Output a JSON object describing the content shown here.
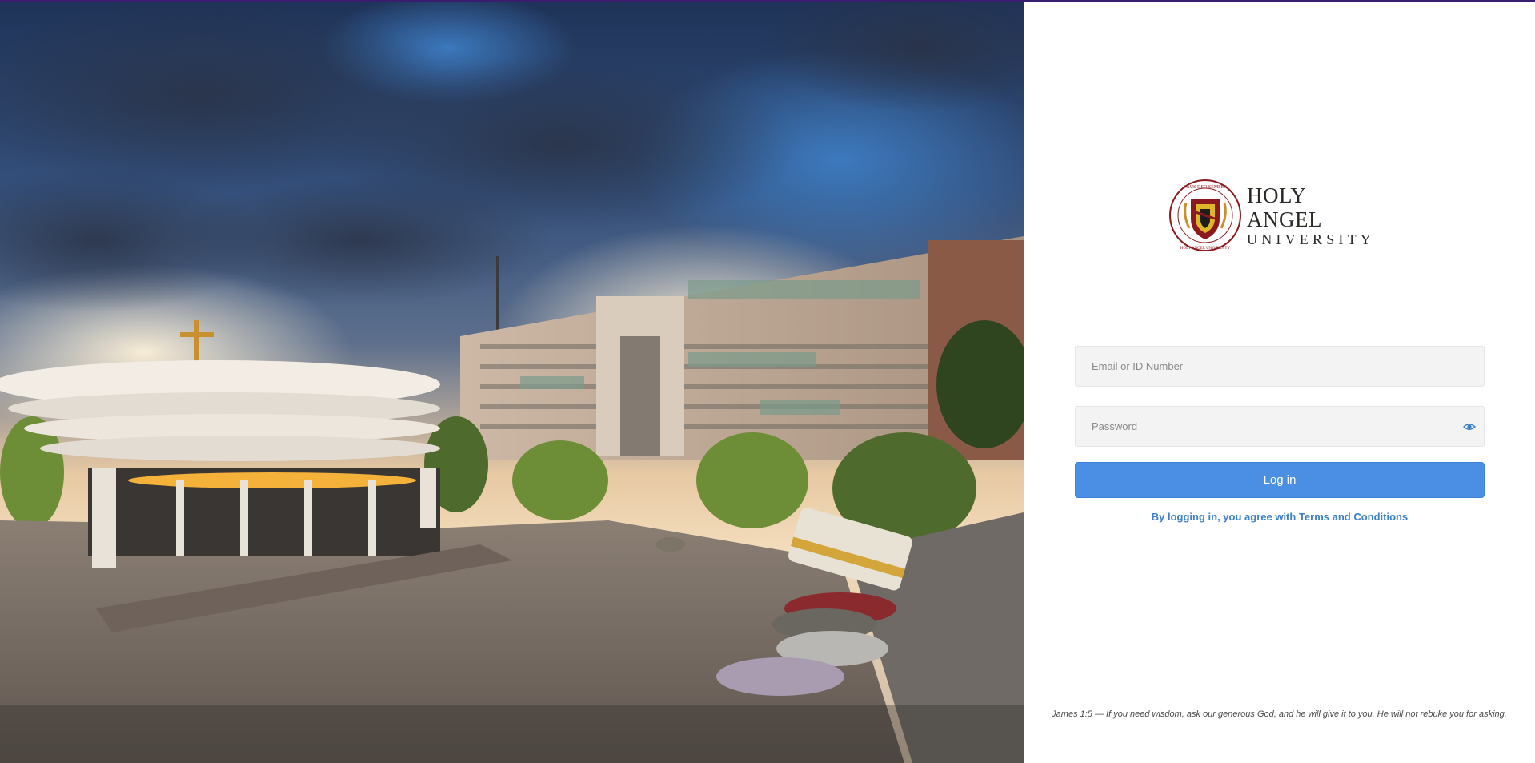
{
  "hero": {
    "image_name": "campus-photo",
    "alt": ""
  },
  "logo": {
    "name_line1": "HOLY ANGEL",
    "name_line2": "UNIVERSITY",
    "seal_text_top": "LAUS DEO SEMPER",
    "seal_text_bottom": "HOLY ANGEL UNIVERSITY",
    "colors": {
      "maroon": "#8b1a1f",
      "gold": "#e0b62a",
      "text": "#2d2a26"
    }
  },
  "form": {
    "email_placeholder": "Email or ID Number",
    "email_value": "",
    "password_placeholder": "Password",
    "password_value": "",
    "show_password_icon": "eye-icon",
    "login_label": "Log in",
    "terms_text": "By logging in, you agree with Terms and Conditions"
  },
  "footer": {
    "verse": "James 1:5 — If you need wisdom, ask our generous God, and he will give it to you. He will not rebuke you for asking."
  },
  "colors": {
    "accent": "#4a8fe3",
    "link": "#3b7fc9",
    "field_bg": "#f3f3f3",
    "top_strip": "#3a1d6e"
  }
}
